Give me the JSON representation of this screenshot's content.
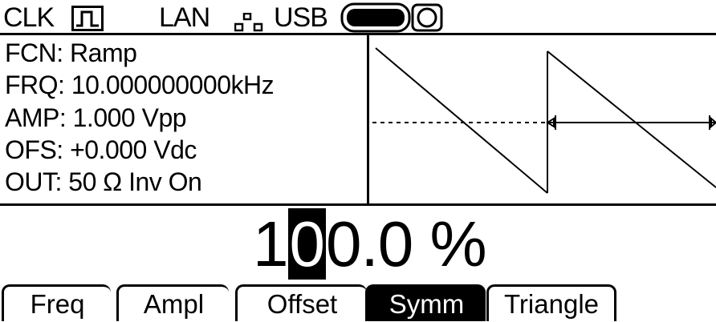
{
  "status": {
    "clk_label": "CLK",
    "lan_label": "LAN",
    "usb_label": "USB",
    "icons": [
      "clock-square-wave-icon",
      "lan-network-icon",
      "usb-connected-icon"
    ]
  },
  "params": {
    "fcn": "FCN: Ramp",
    "frq": "FRQ: 10.000000000kHz",
    "amp": "AMP: 1.000 Vpp",
    "ofs": "OFS: +0.000 Vdc",
    "out": "OUT: 50 Ω Inv On"
  },
  "value": {
    "prefix": "1",
    "cursor_digit": "0",
    "suffix": "0.0 %"
  },
  "softkeys": [
    {
      "label": "Freq",
      "selected": false
    },
    {
      "label": "Ampl",
      "selected": false
    },
    {
      "label": "Offset",
      "selected": false
    },
    {
      "label": "Symm",
      "selected": true
    },
    {
      "label": "Triangle",
      "selected": false
    }
  ],
  "colors": {
    "foreground": "#000000",
    "background": "#ffffff"
  }
}
